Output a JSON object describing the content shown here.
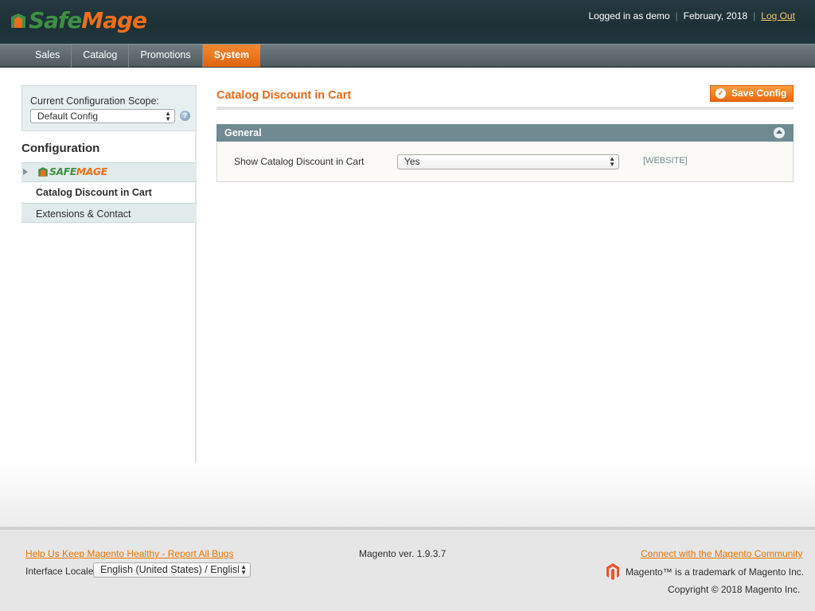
{
  "header": {
    "logo_safe": "Safe",
    "logo_mage": "Mage",
    "logged_in": "Logged in as demo",
    "date": "February, 2018",
    "logout": "Log Out"
  },
  "nav": {
    "items": [
      {
        "label": "Sales"
      },
      {
        "label": "Catalog"
      },
      {
        "label": "Promotions"
      },
      {
        "label": "System"
      }
    ],
    "active": "System"
  },
  "sidebar": {
    "scope_label": "Current Configuration Scope:",
    "scope_value": "Default Config",
    "config_heading": "Configuration",
    "group_logo_safe": "SAFE",
    "group_logo_mage": "MAGE",
    "items": [
      {
        "label": "Catalog Discount in Cart",
        "selected": true
      },
      {
        "label": "Extensions & Contact",
        "selected": false
      }
    ]
  },
  "main": {
    "title": "Catalog Discount in Cart",
    "save_label": "Save Config",
    "section_title": "General",
    "field_label": "Show Catalog Discount in Cart",
    "field_value": "Yes",
    "field_scope": "[WEBSITE]"
  },
  "footer": {
    "bug_link": "Help Us Keep Magento Healthy - Report All Bugs",
    "locale_label": "Interface Locale:",
    "locale_value": "English (United States) / English",
    "version": "Magento ver. 1.9.3.7",
    "community_link": "Connect with the Magento Community",
    "trademark": "Magento™ is a trademark of Magento Inc.",
    "copyright": "Copyright © 2018 Magento Inc."
  },
  "colors": {
    "accent_orange": "#e76a1a",
    "header_bg": "#1c3036",
    "section_head": "#6f8b91",
    "brand_green": "#3f8f46"
  }
}
